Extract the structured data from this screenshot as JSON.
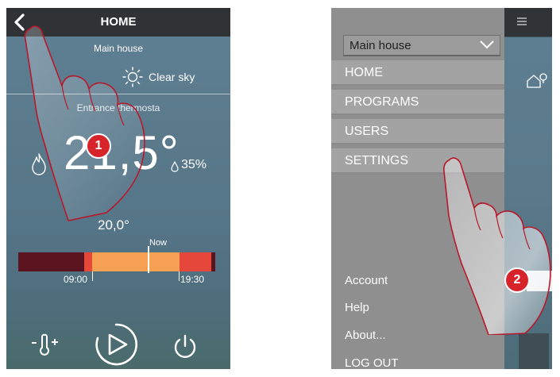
{
  "left_screen": {
    "title": "HOME",
    "house_name": "Main house",
    "weather": "Clear sky",
    "thermostat_name": "Entrance thermosta",
    "temperature": "21,5°",
    "humidity": "35%",
    "setpoint": "20,0°",
    "timeline": {
      "now_label": "Now",
      "start_time": "09:00",
      "end_time": "19:30"
    },
    "controls": {
      "thermometer_icon": "thermometer-plus-icon",
      "play_icon": "play-icon",
      "power_icon": "power-icon"
    },
    "step_badge": "1"
  },
  "right_screen": {
    "house_selector": "Main house",
    "menu_items": [
      "HOME",
      "PROGRAMS",
      "USERS",
      "SETTINGS"
    ],
    "bottom_items": [
      "Account",
      "Help",
      "About...",
      "LOG OUT"
    ],
    "step_badge": "2"
  },
  "colors": {
    "topbar": "#2f3336",
    "menu_bg": "#8f8f8f",
    "menu_item_bg": "#a3a3a3",
    "timeline_dark": "#5b1320",
    "timeline_red": "#e5473b",
    "timeline_orange": "#f5a053",
    "badge": "#d7242b"
  }
}
